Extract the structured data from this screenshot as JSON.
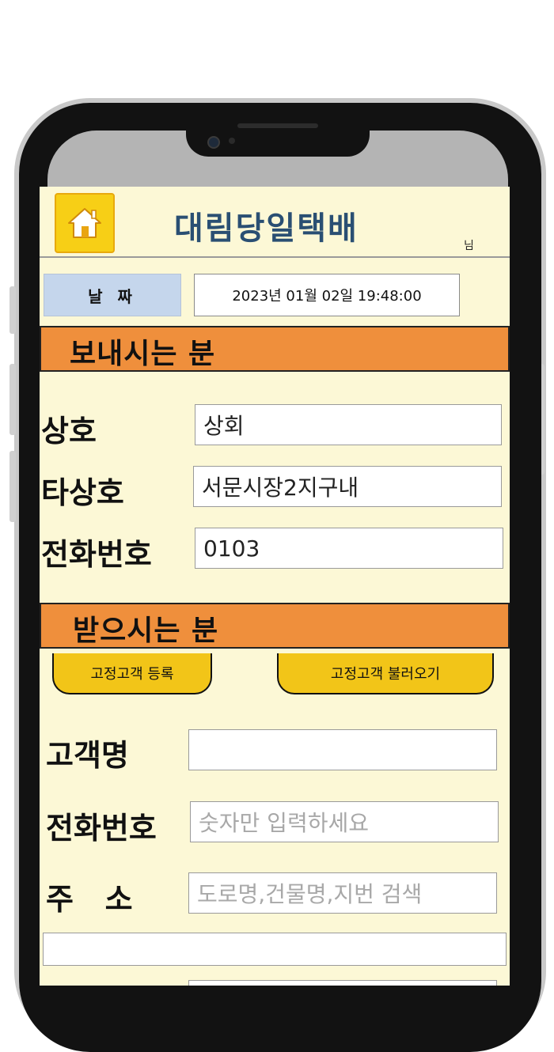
{
  "header": {
    "app_title": "대림당일택배",
    "user_suffix": "님"
  },
  "date_row": {
    "label": "날 짜",
    "value": "2023년  01월  02일 19:48:00"
  },
  "sender": {
    "section_title": "보내시는 분",
    "fields": [
      {
        "label": "상호",
        "value": "상회"
      },
      {
        "label": "타상호",
        "value": "서문시장2지구내"
      },
      {
        "label": "전화번호",
        "value": "0103"
      }
    ]
  },
  "receiver": {
    "section_title": "받으시는 분",
    "register_button": "고정고객 등록",
    "load_button": "고정고객 불러오기",
    "fields": [
      {
        "label": "고객명",
        "value": "",
        "placeholder": ""
      },
      {
        "label": "전화번호",
        "value": "",
        "placeholder": "숫자만 입력하세요"
      },
      {
        "label": "주   소",
        "value": "",
        "placeholder": "도로명,건물명,지번 검색"
      }
    ]
  },
  "colors": {
    "background": "#fcf8d6",
    "section_bar": "#ef8f3c",
    "title": "#2a4f73",
    "home_button": "#f7cf16",
    "pill_button": "#f2c518",
    "date_label": "#c5d6ec"
  },
  "icons": {
    "home": "home-icon"
  }
}
